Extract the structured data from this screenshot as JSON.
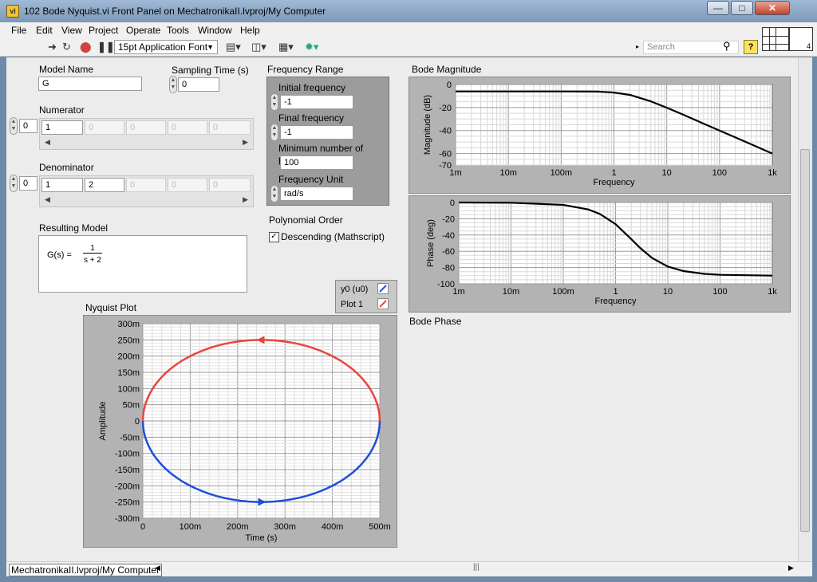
{
  "window": {
    "title": "102 Bode Nyquist.vi Front Panel on MechatronikaII.lvproj/My Computer",
    "icon_glyph": "vi",
    "buttons": [
      "minimize",
      "maximize",
      "close"
    ]
  },
  "menu": [
    "File",
    "Edit",
    "View",
    "Project",
    "Operate",
    "Tools",
    "Window",
    "Help"
  ],
  "toolbar": {
    "font_select": "15pt Application Font",
    "search_placeholder": "Search",
    "help_glyph": "?",
    "connector_pane_glyph": "4"
  },
  "controls": {
    "model_name_label": "Model Name",
    "model_name_value": "G",
    "sampling_time_label": "Sampling Time (s)",
    "sampling_time_value": "0",
    "numerator_label": "Numerator",
    "numerator_index": "0",
    "numerator_values": [
      "1",
      "0",
      "0",
      "0",
      "0"
    ],
    "denominator_label": "Denominator",
    "denominator_index": "0",
    "denominator_values": [
      "1",
      "2",
      "0",
      "0",
      "0"
    ],
    "resulting_model_label": "Resulting Model",
    "resulting_model_lhs": "G(s) =",
    "resulting_model_num": "1",
    "resulting_model_den": "s + 2",
    "frequency_range": {
      "label": "Frequency Range",
      "initial_label": "Initial frequency",
      "initial_value": "-1",
      "final_label": "Final frequency",
      "final_value": "-1",
      "min_points_label": "Minimum number of points",
      "min_points_value": "100",
      "unit_label": "Frequency Unit",
      "unit_value": "rad/s"
    },
    "polynomial_order_label": "Polynomial Order",
    "descending_label": "Descending (Mathscript)",
    "descending_checked": true
  },
  "legend": [
    {
      "name": "y0 (u0)",
      "color": "#1f4fd8"
    },
    {
      "name": "Plot 1",
      "color": "#e8463c"
    }
  ],
  "bode_magnitude": {
    "title": "Bode Magnitude",
    "xlabel": "Frequency",
    "ylabel": "Magnitude (dB)",
    "xticks": [
      "1m",
      "10m",
      "100m",
      "1",
      "10",
      "100",
      "1k"
    ],
    "yticks": [
      "0",
      "-20",
      "-40",
      "-60",
      "-70"
    ]
  },
  "bode_phase": {
    "title": "Bode Phase",
    "xlabel": "Frequency",
    "ylabel": "Phase (deg)",
    "xticks": [
      "1m",
      "10m",
      "100m",
      "1",
      "10",
      "100",
      "1k"
    ],
    "yticks": [
      "0",
      "-20",
      "-40",
      "-60",
      "-80",
      "-100"
    ]
  },
  "nyquist": {
    "title": "Nyquist Plot",
    "xlabel": "Time (s)",
    "ylabel": "Amplitude",
    "xticks": [
      "0",
      "100m",
      "200m",
      "300m",
      "400m",
      "500m"
    ],
    "yticks": [
      "300m",
      "250m",
      "200m",
      "150m",
      "100m",
      "50m",
      "0",
      "-50m",
      "-100m",
      "-150m",
      "-200m",
      "-250m",
      "-300m"
    ]
  },
  "chart_data": [
    {
      "type": "line",
      "title": "Bode Magnitude",
      "xlabel": "Frequency",
      "ylabel": "Magnitude (dB)",
      "xscale": "log",
      "xlim": [
        0.001,
        1000
      ],
      "ylim": [
        -70,
        0
      ],
      "grid": true,
      "series": [
        {
          "x": [
            0.001,
            0.01,
            0.1,
            0.5,
            1,
            2,
            5,
            10,
            20,
            50,
            100,
            200,
            500,
            1000
          ],
          "values": [
            -6,
            -6,
            -6,
            -6.2,
            -7,
            -9,
            -14.6,
            -20.2,
            -26,
            -34,
            -40,
            -46,
            -54,
            -60
          ]
        }
      ]
    },
    {
      "type": "line",
      "title": "Bode Phase",
      "xlabel": "Frequency",
      "ylabel": "Phase (deg)",
      "xscale": "log",
      "xlim": [
        0.001,
        1000
      ],
      "ylim": [
        -100,
        0
      ],
      "grid": true,
      "series": [
        {
          "x": [
            0.001,
            0.01,
            0.1,
            0.3,
            0.5,
            1,
            2,
            3,
            5,
            10,
            20,
            50,
            100,
            1000
          ],
          "values": [
            0,
            -0.3,
            -2.9,
            -8.5,
            -14,
            -26.6,
            -45,
            -56.3,
            -68.2,
            -78.7,
            -84.3,
            -87.7,
            -88.9,
            -89.9
          ]
        }
      ]
    },
    {
      "type": "line",
      "title": "Nyquist Plot",
      "xlabel": "Time (s)",
      "ylabel": "Amplitude",
      "xlim": [
        0,
        0.5
      ],
      "ylim": [
        -0.3,
        0.3
      ],
      "grid": true,
      "series": [
        {
          "name": "y0 (u0)",
          "shape": "lower half-circle from (0,0) to (0.5,0)",
          "center": [
            0.25,
            0
          ],
          "radius": 0.25
        },
        {
          "name": "Plot 1",
          "shape": "upper half-circle from (0,0) to (0.5,0)",
          "center": [
            0.25,
            0
          ],
          "radius": 0.25
        }
      ]
    }
  ]
}
